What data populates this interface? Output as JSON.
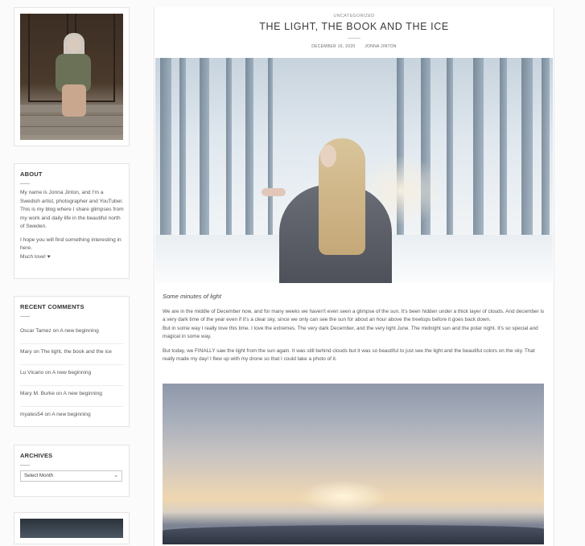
{
  "sidebar": {
    "about": {
      "title": "ABOUT",
      "text1": "My name is Jonna Jinton, and I'm a Swedish artist, photographer and YouTuber. This is my blog where I share glimpses from my work and daily life in the beautiful north of Sweden.",
      "text2": "I hope you will find something interesting in here.",
      "text3": "Much love! ♥"
    },
    "recent_comments": {
      "title": "RECENT COMMENTS",
      "items": [
        {
          "author": "Oscar Tamez",
          "on": "on",
          "post": "A new beginning"
        },
        {
          "author": "Mary",
          "on": "on",
          "post": "The light, the book and the ice"
        },
        {
          "author": "Lu Vicario",
          "on": "on",
          "post": "A new beginning"
        },
        {
          "author": "Mary M. Burke",
          "on": "on",
          "post": "A new beginning"
        },
        {
          "author": "myates54",
          "on": "on",
          "post": "A new beginning"
        }
      ]
    },
    "archives": {
      "title": "ARCHIVES",
      "select_value": "Select Month"
    }
  },
  "article": {
    "category": "UNCATEGORIZED",
    "title": "THE LIGHT, THE BOOK AND THE ICE",
    "date": "DECEMBER 16, 2020",
    "author": "JONNA JINTON",
    "caption": "Some minutes of light",
    "p1": "We are in the middle of December now, and for many weeks we haven't even seen a glimpse of the sun. It's been hidden under a thick layer of clouds. And december is a very dark time of the year even if it's a clear sky, since we only can see the sun for about an hour above the treetops before it goes back down.",
    "p1b": "But in some way I really love this time. I love the extremes. The very dark December, and the very light June. The midnight sun and the polar night. It's so special and magical in some way.",
    "p2": "But today, we FINALLY saw the light from the sun again. It was still behind clouds but it was so beautiful to just see the light and the beautiful colors on the sky. That really made my day! I flew up with my drone so that I could take a photo of it."
  },
  "icons": {
    "select_chevron": "chevron-down-icon"
  }
}
